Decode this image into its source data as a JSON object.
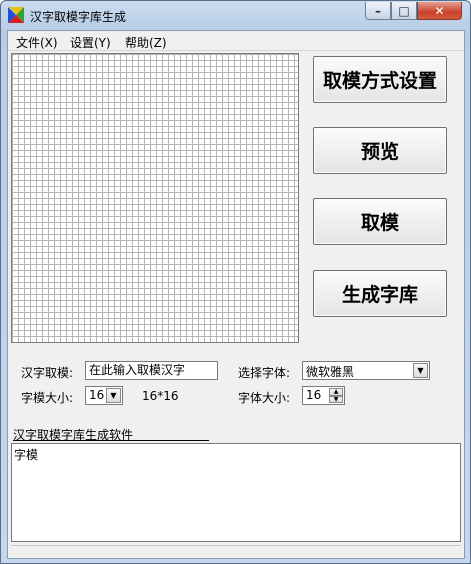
{
  "window": {
    "title": "汉字取模字库生成",
    "controls": {
      "minimize": "–",
      "maximize": "□",
      "close": "✕"
    }
  },
  "menu": [
    "文件(X)",
    "设置(Y)",
    "帮助(Z)"
  ],
  "buttons": {
    "mold_settings": "取模方式设置",
    "preview": "预览",
    "take_mold": "取模",
    "generate_library": "生成字库"
  },
  "form": {
    "char_label": "汉字取模:",
    "char_value": "在此输入取模汉字",
    "font_select_label": "选择字体:",
    "font_select_value": "微软雅黑",
    "mold_size_label": "字模大小:",
    "mold_size_value": "16",
    "mold_size_display": "16*16",
    "font_size_label": "字体大小:",
    "font_size_value": "16"
  },
  "output": {
    "caption": "汉字取模字库生成软件",
    "text": "字模"
  }
}
